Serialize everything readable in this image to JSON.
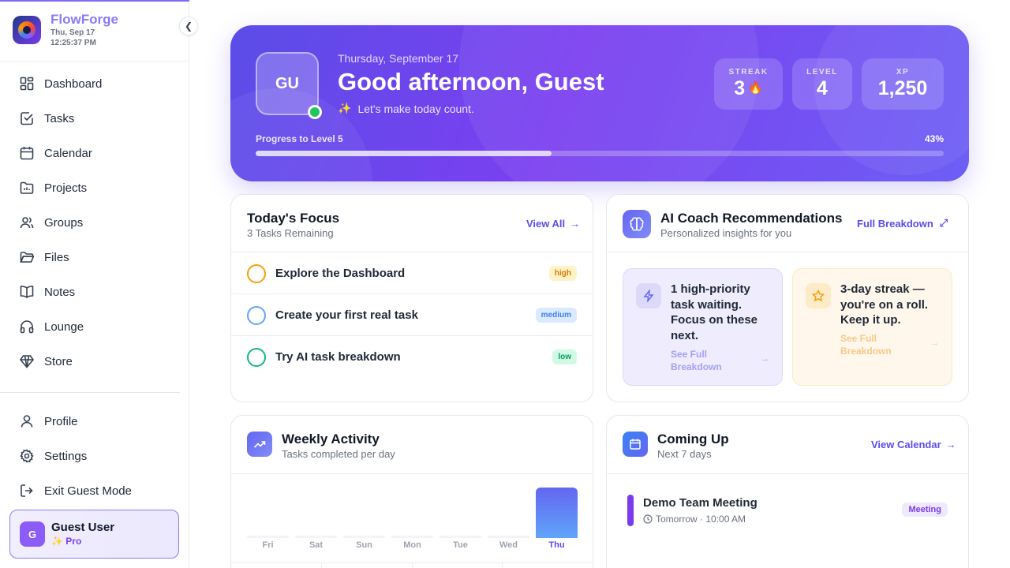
{
  "app": {
    "name": "FlowForge",
    "date": "Thu, Sep 17",
    "time": "12:25:37 PM"
  },
  "sidebar": {
    "items": [
      {
        "label": "Dashboard",
        "icon": "dashboard-icon"
      },
      {
        "label": "Tasks",
        "icon": "tasks-icon"
      },
      {
        "label": "Calendar",
        "icon": "calendar-icon"
      },
      {
        "label": "Projects",
        "icon": "projects-icon"
      },
      {
        "label": "Groups",
        "icon": "groups-icon"
      },
      {
        "label": "Files",
        "icon": "folder-icon"
      },
      {
        "label": "Notes",
        "icon": "book-icon"
      },
      {
        "label": "Lounge",
        "icon": "headphones-icon"
      },
      {
        "label": "Store",
        "icon": "diamond-icon"
      }
    ],
    "bottom": [
      {
        "label": "Profile",
        "icon": "user-icon"
      },
      {
        "label": "Settings",
        "icon": "gear-icon"
      },
      {
        "label": "Exit Guest Mode",
        "icon": "logout-icon"
      }
    ],
    "user": {
      "initial": "G",
      "name": "Guest User",
      "plan": "✨ Pro"
    }
  },
  "hero": {
    "initials": "GU",
    "date": "Thursday, September 17",
    "greeting": "Good afternoon, Guest",
    "subtitle": "Let's make today count.",
    "stats": [
      {
        "label": "STREAK",
        "value": "3"
      },
      {
        "label": "LEVEL",
        "value": "4"
      },
      {
        "label": "XP",
        "value": "1,250"
      }
    ],
    "progress_label": "Progress to Level 5",
    "progress_pct_text": "43%",
    "progress_fraction": 0.43
  },
  "focus": {
    "title": "Today's Focus",
    "subtitle": "3 Tasks Remaining",
    "link": "View All",
    "tasks": [
      {
        "name": "Explore the Dashboard",
        "priority": "high",
        "color": "#f59e0b",
        "badge_bg": "#fef3c7",
        "badge_fg": "#d97706"
      },
      {
        "name": "Create your first real task",
        "priority": "medium",
        "color": "#60a5fa",
        "badge_bg": "#dbeafe",
        "badge_fg": "#3b82f6"
      },
      {
        "name": "Try AI task breakdown",
        "priority": "low",
        "color": "#10b981",
        "badge_bg": "#d1fae5",
        "badge_fg": "#059669"
      }
    ]
  },
  "coach": {
    "title": "AI Coach Recommendations",
    "subtitle": "Personalized insights for you",
    "link": "Full Breakdown",
    "recs": [
      {
        "text": "1 high-priority task waiting. Focus on these next.",
        "link": "See Full Breakdown",
        "icon": "bolt-icon"
      },
      {
        "text": "3-day streak — you're on a roll. Keep it up.",
        "link": "See Full Breakdown",
        "icon": "star-icon"
      }
    ]
  },
  "weekly": {
    "title": "Weekly Activity",
    "subtitle": "Tasks completed per day"
  },
  "chart_data": {
    "type": "bar",
    "categories": [
      "Fri",
      "Sat",
      "Sun",
      "Mon",
      "Tue",
      "Wed",
      "Thu"
    ],
    "values": [
      0,
      0,
      0,
      0,
      0,
      0,
      1
    ],
    "highlight": "Thu",
    "colors": {
      "bar": "#6366f1",
      "empty": "#f3f4f6"
    }
  },
  "upcoming": {
    "title": "Coming Up",
    "subtitle": "Next 7 days",
    "link": "View Calendar",
    "events": [
      {
        "title": "Demo Team Meeting",
        "time": "Tomorrow · 10:00 AM",
        "badge": "Meeting"
      }
    ]
  },
  "colors": {
    "accent": "#5b4de8",
    "brand": "#8b7cf6"
  }
}
